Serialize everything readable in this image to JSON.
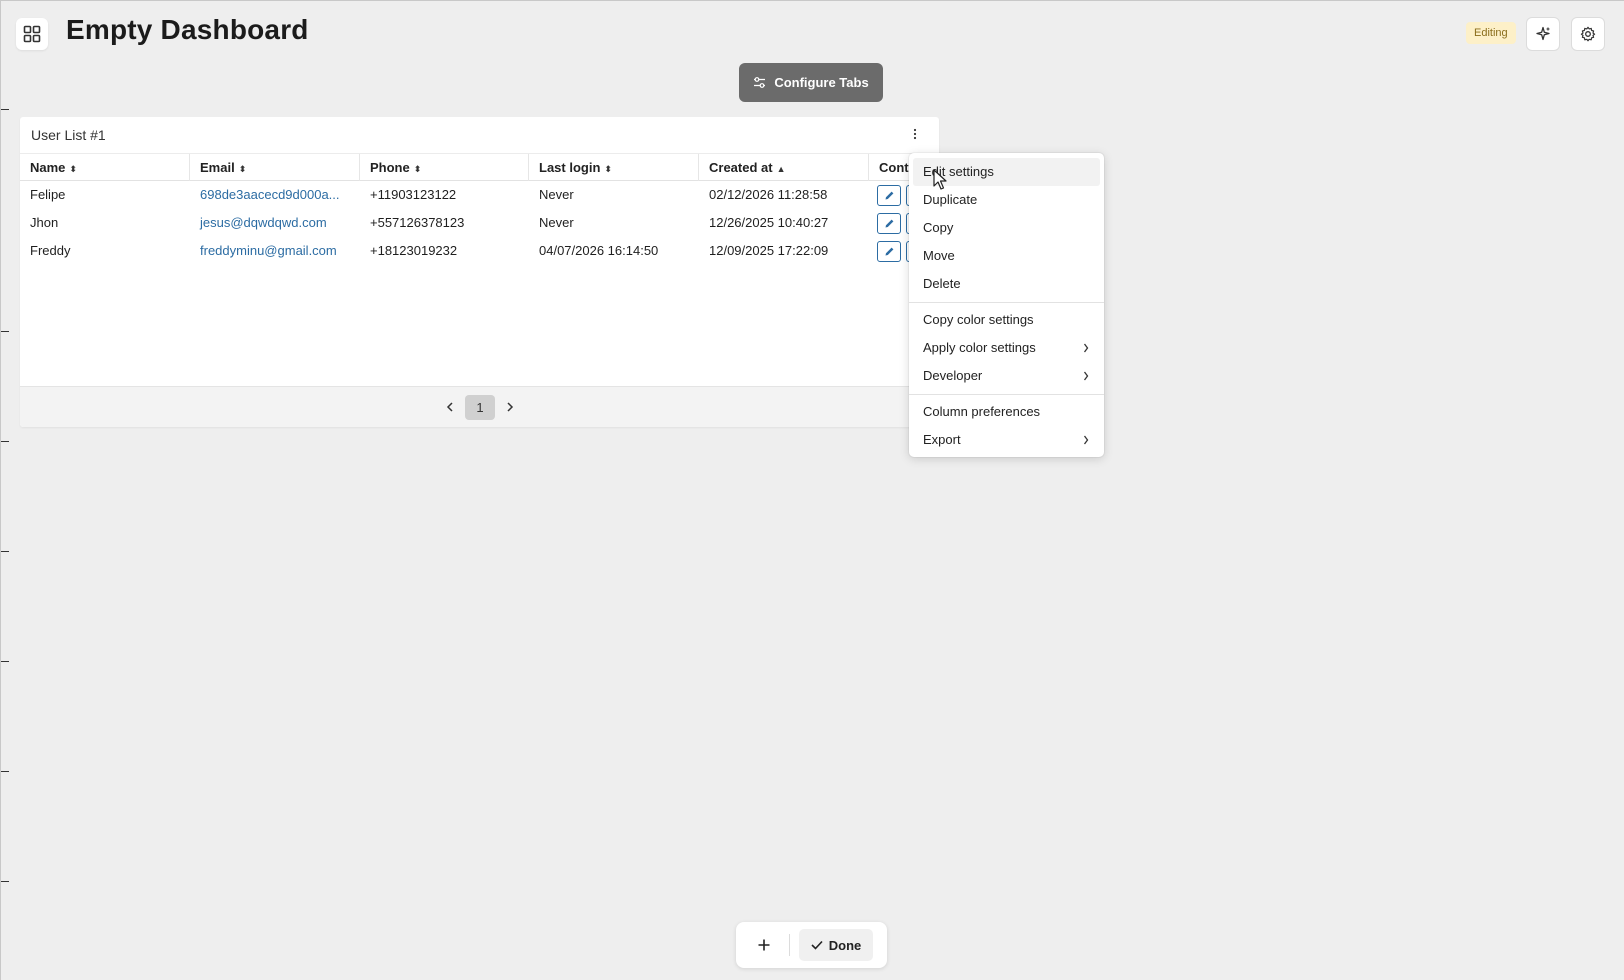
{
  "header": {
    "title": "Empty Dashboard",
    "status_badge": "Editing"
  },
  "configure_tabs_label": "Configure Tabs",
  "widget": {
    "title": "User List #1",
    "columns": [
      "Name",
      "Email",
      "Phone",
      "Last login",
      "Created at",
      "Contr"
    ],
    "rows": [
      {
        "name": "Felipe",
        "email": "698de3aacecd9d000a...",
        "phone": "+11903123122",
        "last_login": "Never",
        "created_at": "02/12/2026 11:28:58"
      },
      {
        "name": "Jhon",
        "email": "jesus@dqwdqwd.com",
        "phone": "+557126378123",
        "last_login": "Never",
        "created_at": "12/26/2025 10:40:27"
      },
      {
        "name": "Freddy",
        "email": "freddyminu@gmail.com",
        "phone": "+18123019232",
        "last_login": "04/07/2026 16:14:50",
        "created_at": "12/09/2025 17:22:09"
      }
    ],
    "pagination": {
      "current_page": "1"
    }
  },
  "context_menu": {
    "items": [
      {
        "label": "Edit settings"
      },
      {
        "label": "Duplicate"
      },
      {
        "label": "Copy"
      },
      {
        "label": "Move"
      },
      {
        "label": "Delete"
      },
      {
        "label": "Copy color settings"
      },
      {
        "label": "Apply color settings"
      },
      {
        "label": "Developer"
      },
      {
        "label": "Column preferences"
      },
      {
        "label": "Export"
      }
    ]
  },
  "bottom_bar": {
    "done_label": "Done"
  },
  "icons": [
    "apps-grid-icon",
    "sparkle-icon",
    "gear-icon",
    "sliders-icon",
    "more-vertical-icon",
    "pencil-icon",
    "chevron-left-icon",
    "chevron-right-icon",
    "plus-icon",
    "check-icon",
    "cursor-arrow-icon"
  ],
  "colors": {
    "link": "#2c6ca3",
    "badge_bg": "#fdf0c8",
    "badge_text": "#8a6d1b",
    "configure_bg": "#6b6b6b"
  }
}
